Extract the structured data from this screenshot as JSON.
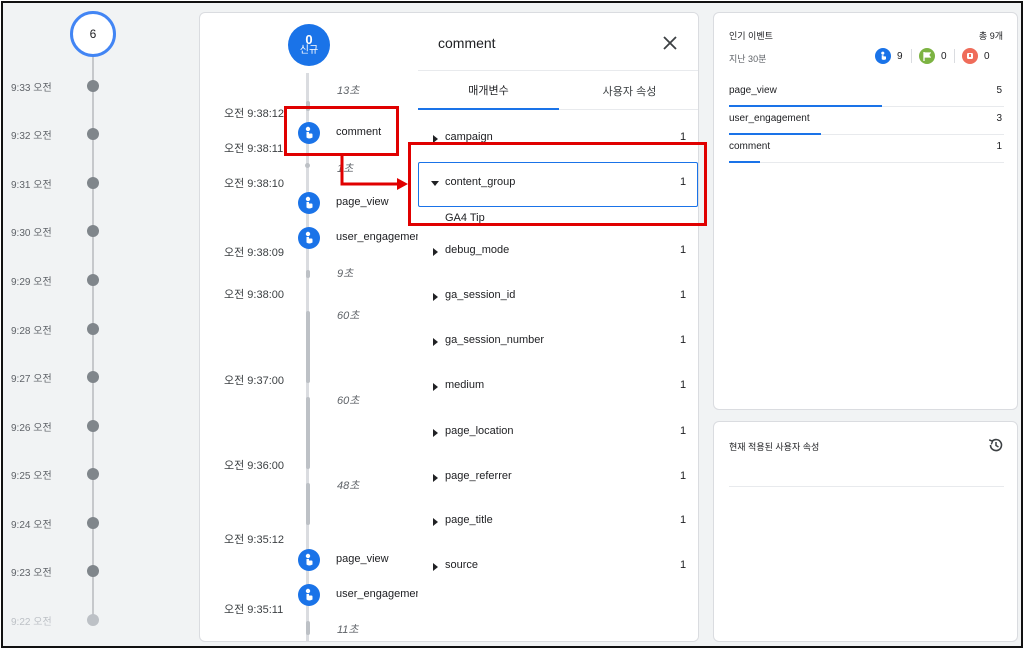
{
  "minute_timeline": {
    "top_count": "6",
    "minutes": [
      "9:33 오전",
      "9:32 오전",
      "9:31 오전",
      "9:30 오전",
      "9:29 오전",
      "9:28 오전",
      "9:27 오전",
      "9:26 오전",
      "9:25 오전",
      "9:24 오전",
      "9:23 오전",
      "9:22 오전"
    ]
  },
  "event_stream": {
    "new_badge": {
      "count": "0",
      "label": "신규"
    },
    "gaps": [
      "13초",
      "1초",
      "9초",
      "60초",
      "60초",
      "48초",
      "11초"
    ],
    "timestamps": [
      "오전 9:38:12",
      "오전 9:38:11",
      "오전 9:38:10",
      "오전 9:38:09",
      "오전 9:38:00",
      "오전 9:37:00",
      "오전 9:36:00",
      "오전 9:35:12",
      "오전 9:35:11"
    ],
    "events": [
      "comment",
      "page_view",
      "user_engagement",
      "page_view",
      "user_engagement"
    ]
  },
  "detail": {
    "title": "comment",
    "tabs": [
      "매개변수",
      "사용자 속성"
    ],
    "params": [
      {
        "name": "campaign",
        "count": "1"
      },
      {
        "name": "content_group",
        "count": "1"
      },
      {
        "name": "debug_mode",
        "count": "1"
      },
      {
        "name": "ga_session_id",
        "count": "1"
      },
      {
        "name": "ga_session_number",
        "count": "1"
      },
      {
        "name": "medium",
        "count": "1"
      },
      {
        "name": "page_location",
        "count": "1"
      },
      {
        "name": "page_referrer",
        "count": "1"
      },
      {
        "name": "page_title",
        "count": "1"
      },
      {
        "name": "source",
        "count": "1"
      }
    ],
    "expanded_value": "GA4 Tip"
  },
  "top_events": {
    "title": "인기 이벤트",
    "total": "총 9개",
    "period": "지난 30분",
    "counters": [
      {
        "icon": "user-event-icon",
        "value": "9",
        "color": "#1a73e8"
      },
      {
        "icon": "flag-icon",
        "value": "0",
        "color": "#7cb342"
      },
      {
        "icon": "error-icon",
        "value": "0",
        "color": "#ef6c5a"
      }
    ],
    "rows": [
      {
        "name": "page_view",
        "count": "5",
        "share": 0.556
      },
      {
        "name": "user_engagement",
        "count": "3",
        "share": 0.333
      },
      {
        "name": "comment",
        "count": "1",
        "share": 0.111
      }
    ]
  },
  "user_props": {
    "title": "현재 적용된 사용자 속성",
    "icon": "history-icon"
  },
  "colors": {
    "accent": "#1a73e8",
    "annotation": "#e00000"
  }
}
